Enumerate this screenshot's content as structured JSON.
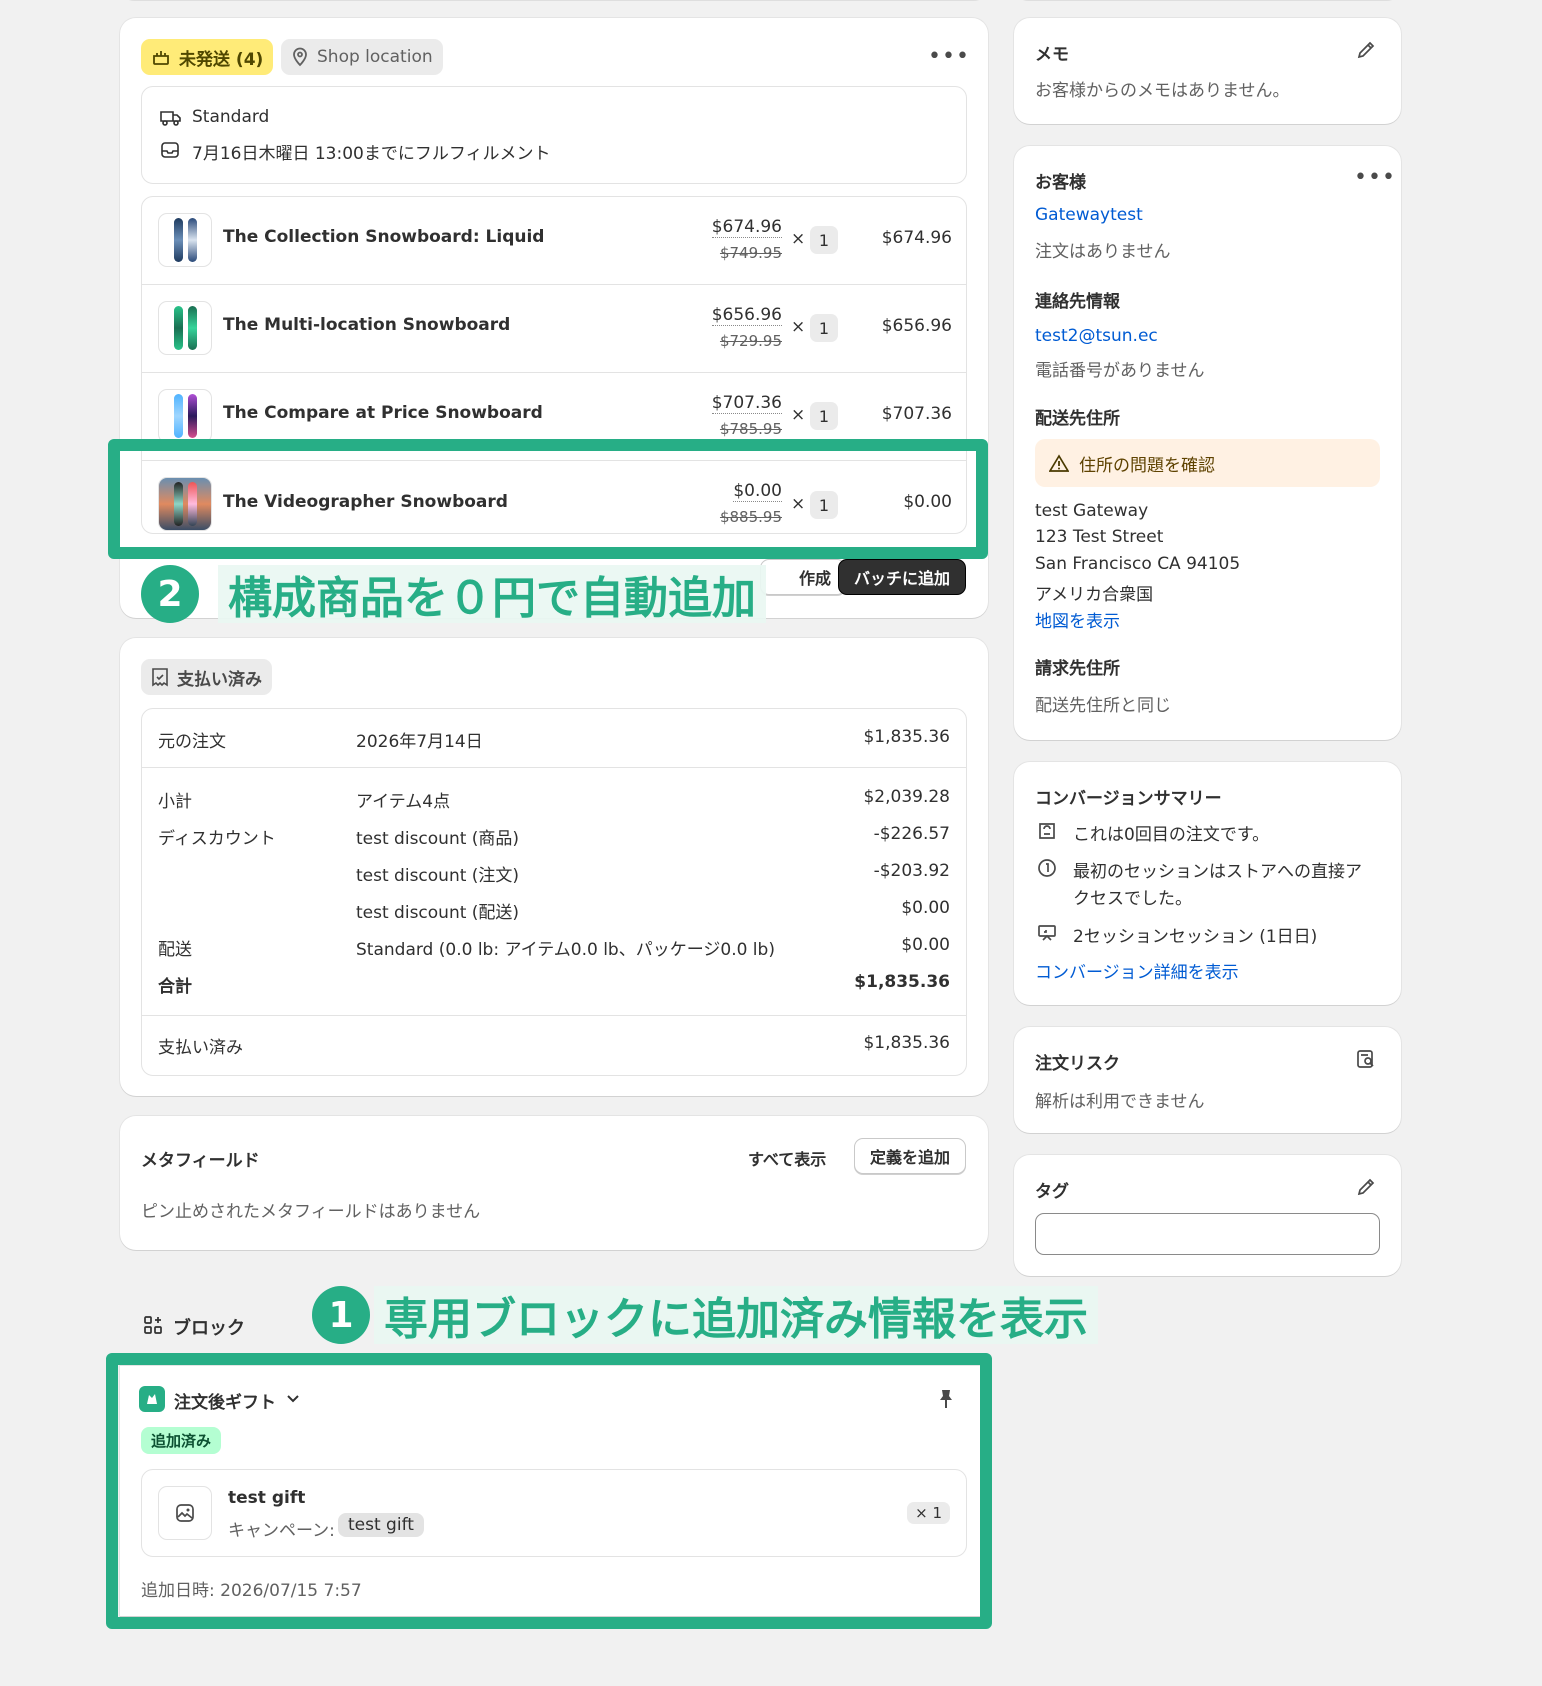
{
  "fulfillment": {
    "status_label": "未発送 (4)",
    "location_label": "Shop location",
    "shipping_method": "Standard",
    "deadline": "7月16日木曜日 13:00までにフルフィルメント",
    "items": [
      {
        "name": "The Collection Snowboard: Liquid",
        "price": "$674.96",
        "compare": "$749.95",
        "qty": "1",
        "total": "$674.96"
      },
      {
        "name": "The Multi-location Snowboard",
        "price": "$656.96",
        "compare": "$729.95",
        "qty": "1",
        "total": "$656.96"
      },
      {
        "name": "The Compare at Price Snowboard",
        "price": "$707.36",
        "compare": "$785.95",
        "qty": "1",
        "total": "$707.36"
      },
      {
        "name": "The Videographer Snowboard",
        "price": "$0.00",
        "compare": "$885.95",
        "qty": "1",
        "total": "$0.00"
      }
    ],
    "times": "×",
    "create_label_partial": "作成",
    "batch_button": "バッチに追加"
  },
  "payment": {
    "status_label": "支払い済み",
    "original_order_label": "元の注文",
    "original_order_date": "2026年7月14日",
    "original_order_amount": "$1,835.36",
    "rows": [
      {
        "label": "小計",
        "desc": "アイテム4点",
        "amount": "$2,039.28",
        "bold": false
      },
      {
        "label": "ディスカウント",
        "desc": "test discount (商品)",
        "amount": "-$226.57",
        "bold": false
      },
      {
        "label": "",
        "desc": "test discount (注文)",
        "amount": "-$203.92",
        "bold": false
      },
      {
        "label": "",
        "desc": "test discount (配送)",
        "amount": "$0.00",
        "bold": false
      },
      {
        "label": "配送",
        "desc": "Standard (0.0 lb: アイテム0.0 lb、パッケージ0.0 lb)",
        "amount": "$0.00",
        "bold": false
      },
      {
        "label": "合計",
        "desc": "",
        "amount": "$1,835.36",
        "bold": true
      }
    ],
    "paid_label": "支払い済み",
    "paid_amount": "$1,835.36"
  },
  "metafields": {
    "title": "メタフィールド",
    "show_all": "すべて表示",
    "add_definition": "定義を追加",
    "empty_text": "ピン止めされたメタフィールドはありません"
  },
  "blocks": {
    "title": "ブロック",
    "app_name": "注文後ギフト",
    "badge": "追加済み",
    "gift_name": "test gift",
    "campaign_label": "キャンペーン:",
    "campaign_value": "test gift",
    "gift_qty": "× 1",
    "added_at": "追加日時: 2026/07/15 7:57"
  },
  "sidebar": {
    "memo": {
      "title": "メモ",
      "text": "お客様からのメモはありません。"
    },
    "customer": {
      "title": "お客様",
      "name": "Gatewaytest",
      "orders": "注文はありません",
      "contact_title": "連絡先情報",
      "email": "test2@tsun.ec",
      "phone": "電話番号がありません",
      "shipping_title": "配送先住所",
      "address_warning": "住所の問題を確認",
      "address_lines": [
        "test Gateway",
        "123 Test Street",
        "San Francisco CA 94105",
        "アメリカ合衆国"
      ],
      "map_link": "地図を表示",
      "billing_title": "請求先住所",
      "billing_text": "配送先住所と同じ"
    },
    "conversion": {
      "title": "コンバージョンサマリー",
      "line1": "これは0回目の注文です。",
      "line2a": "最初のセッションはストアへの直接ア",
      "line2b": "クセスでした。",
      "line3": "2セッションセッション (1日日)",
      "link": "コンバージョン詳細を表示"
    },
    "risk": {
      "title": "注文リスク",
      "text": "解析は利用できません"
    },
    "tags": {
      "title": "タグ",
      "input_value": ""
    }
  },
  "annotations": {
    "one_number": "1",
    "one_text": "専用ブロックに追加済み情報を表示",
    "two_number": "2",
    "two_text": "構成商品を０円で自動追加"
  },
  "colors": {
    "accent_green": "#27ae86",
    "unfulfilled_yellow": "#ffeb78",
    "warning_bg": "#fff1e3",
    "link_blue": "#005bd3"
  }
}
